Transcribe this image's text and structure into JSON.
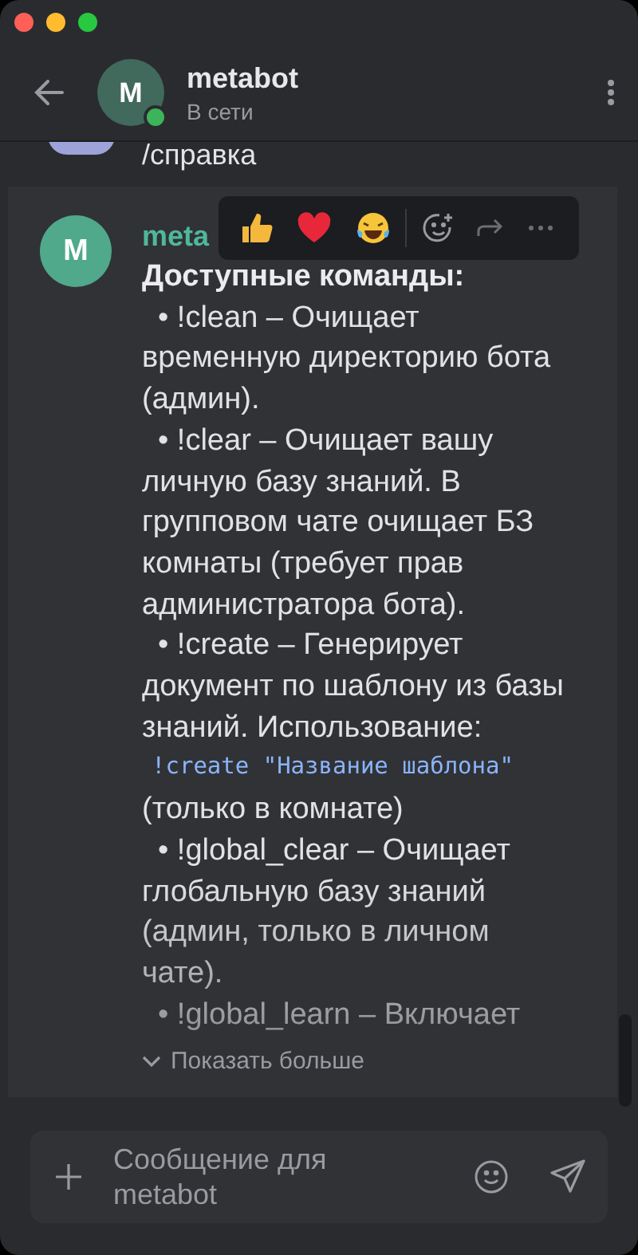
{
  "header": {
    "avatar_letter": "M",
    "name": "metabot",
    "status": "В сети",
    "online": true
  },
  "previous_message": {
    "text": "/справка"
  },
  "message": {
    "avatar_letter": "M",
    "sender": "meta",
    "title": "Доступные команды:",
    "items": [
      {
        "text": "• !clean – Очищает временную директорию бота (админ)."
      },
      {
        "text": "• !clear – Очищает вашу личную базу знаний. В групповом чате очищает БЗ комнаты (требует прав администратора бота)."
      },
      {
        "text": "• !create – Генерирует документ по шаблону из базы знаний. Использование:",
        "code": "!create \"Название шаблона\"",
        "after": "(только в комнате)"
      },
      {
        "text": "• !global_clear – Очищает глобальную базу знаний (админ, только в личном чате)."
      },
      {
        "text": "• !global_learn – Включает"
      }
    ],
    "show_more": "Показать больше"
  },
  "composer": {
    "placeholder": "Сообщение для metabot"
  }
}
